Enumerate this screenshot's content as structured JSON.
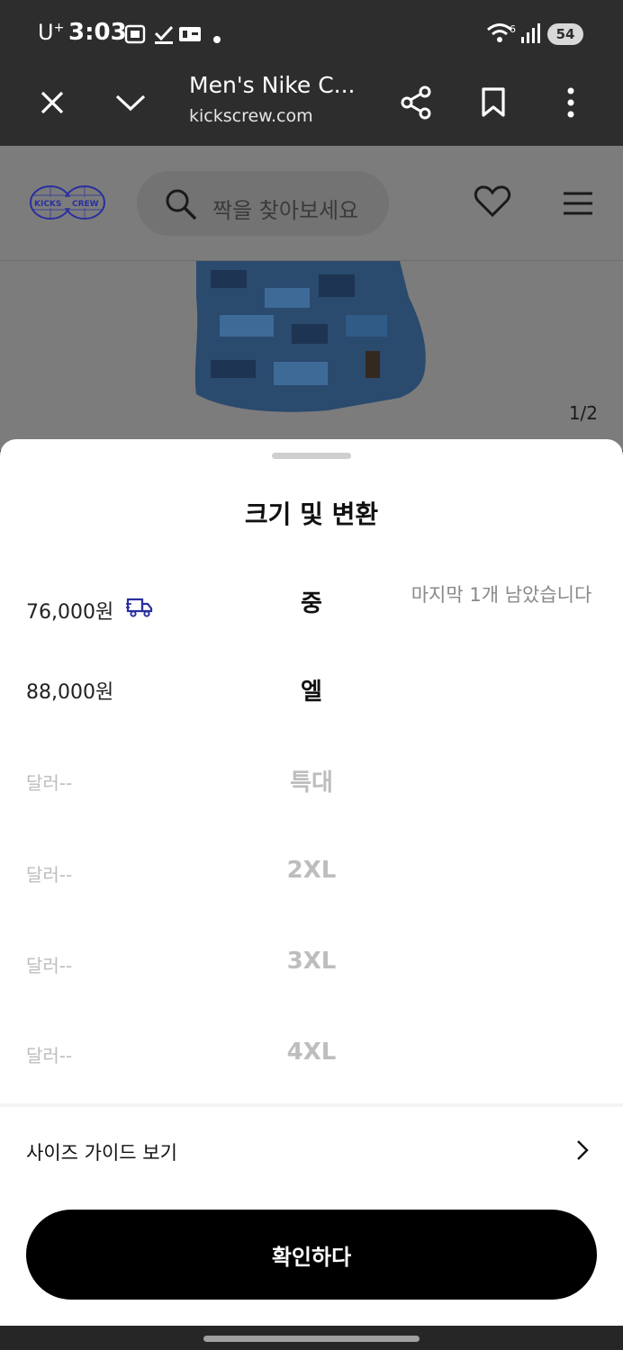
{
  "status_bar": {
    "carrier": "U",
    "carrier_sup": "+",
    "time": "3:03",
    "battery": "54",
    "signal_label": "6",
    "icons": [
      "screenshot-icon",
      "check-icon",
      "nplus-icon",
      "dot-icon",
      "wifi-icon",
      "signal-icon",
      "battery-icon"
    ]
  },
  "browser": {
    "title": "Men's Nike C...",
    "url": "kickscrew.com",
    "icons": [
      "close-icon",
      "chevron-down-icon",
      "share-icon",
      "bookmark-icon",
      "more-vert-icon"
    ]
  },
  "site": {
    "logo_left": "KICKS",
    "logo_right": "CREW",
    "search_placeholder": "짝을 찾아보세요",
    "image_counter": "1/2",
    "icons": [
      "search-icon",
      "heart-icon",
      "menu-icon"
    ]
  },
  "sheet": {
    "title": "크기 및 변환",
    "rows": [
      {
        "price": "76,000원",
        "size": "중",
        "note": "마지막 1개 남았습니다",
        "shipping_icon": true,
        "available": true
      },
      {
        "price": "88,000원",
        "size": "엘",
        "note": "",
        "shipping_icon": false,
        "available": true
      },
      {
        "price": "달러--",
        "size": "특대",
        "note": "",
        "shipping_icon": false,
        "available": false
      },
      {
        "price": "달러--",
        "size": "2XL",
        "note": "",
        "shipping_icon": false,
        "available": false
      },
      {
        "price": "달러--",
        "size": "3XL",
        "note": "",
        "shipping_icon": false,
        "available": false
      },
      {
        "price": "달러--",
        "size": "4XL",
        "note": "",
        "shipping_icon": false,
        "available": false
      }
    ],
    "size_guide_label": "사이즈 가이드 보기",
    "confirm_label": "확인하다"
  },
  "colors": {
    "accent_logo": "#2a2f9e",
    "sheet_background": "#ffffff",
    "confirm_button": "#000000",
    "disabled_text": "#bdbdbd"
  }
}
